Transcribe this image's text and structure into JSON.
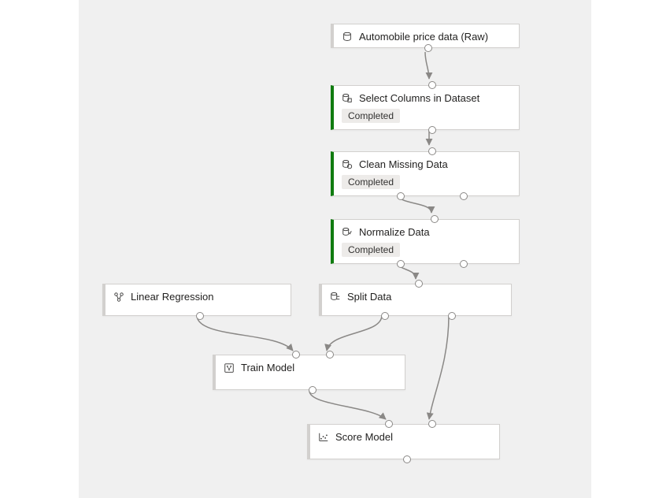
{
  "nodes": {
    "raw": {
      "title": "Automobile price data (Raw)"
    },
    "select": {
      "title": "Select Columns in Dataset",
      "status": "Completed"
    },
    "clean": {
      "title": "Clean Missing Data",
      "status": "Completed"
    },
    "normalize": {
      "title": "Normalize Data",
      "status": "Completed"
    },
    "split": {
      "title": "Split Data"
    },
    "linreg": {
      "title": "Linear Regression"
    },
    "train": {
      "title": "Train Model"
    },
    "score": {
      "title": "Score Model"
    }
  }
}
